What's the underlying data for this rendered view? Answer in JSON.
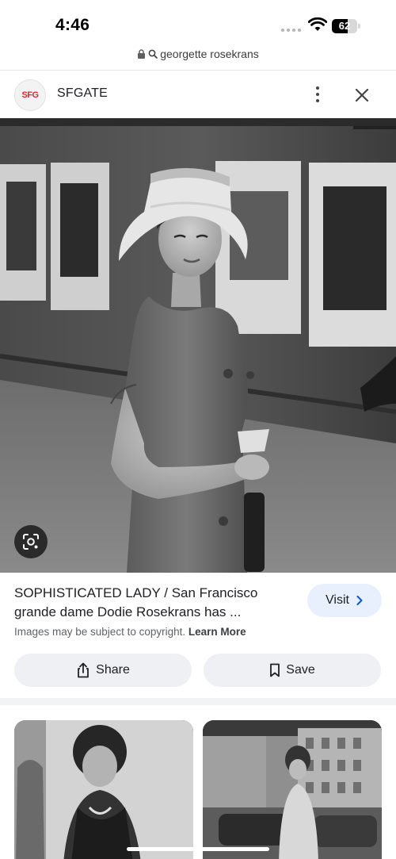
{
  "status_bar": {
    "time": "4:46",
    "battery": "62"
  },
  "url_bar": {
    "query": "georgette rosekrans",
    "lock_icon": "lock-icon",
    "search_icon": "search-icon"
  },
  "source": {
    "logo_text": "SFG",
    "name": "SFGATE"
  },
  "result": {
    "title": "SOPHISTICATED LADY / San Francisco grande dame Dodie Rosekrans has ...",
    "visit_label": "Visit",
    "copyright_text": "Images may be subject to copyright.",
    "learn_more": "Learn More"
  },
  "actions": {
    "share_label": "Share",
    "save_label": "Save"
  },
  "colors": {
    "accent": "#0b57d0",
    "visit_bg": "#e8f0fe",
    "button_bg": "#eef0f3",
    "logo_red": "#e8242f"
  }
}
